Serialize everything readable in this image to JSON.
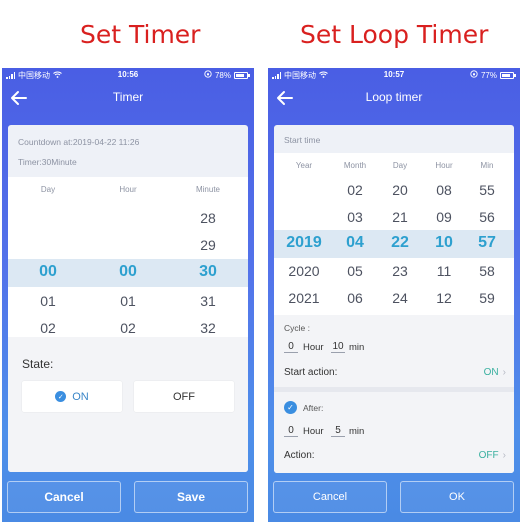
{
  "captions": {
    "left": "Set Timer",
    "right": "Set Loop Timer"
  },
  "left": {
    "status": {
      "carrier": "中国移动",
      "time": "10:56",
      "battery": "78%",
      "battery_level": 0.78
    },
    "title": "Timer",
    "countdown": "Countdown at:2019-04-22 11:26",
    "timer": "Timer:30Minute",
    "columns": [
      "Day",
      "Hour",
      "Minute"
    ],
    "wheels": [
      [
        "",
        "",
        "00",
        "01",
        "02"
      ],
      [
        "",
        "",
        "00",
        "01",
        "02"
      ],
      [
        "28",
        "29",
        "30",
        "31",
        "32"
      ]
    ],
    "state_label": "State:",
    "on_label": "ON",
    "off_label": "OFF",
    "cancel": "Cancel",
    "save": "Save"
  },
  "right": {
    "status": {
      "carrier": "中国移动",
      "time": "10:57",
      "battery": "77%",
      "battery_level": 0.77
    },
    "title": "Loop timer",
    "start_time": "Start time",
    "columns": [
      "Year",
      "Month",
      "Day",
      "Hour",
      "Min"
    ],
    "wheels": [
      [
        "",
        "",
        "2019",
        "2020",
        "2021"
      ],
      [
        "02",
        "03",
        "04",
        "05",
        "06"
      ],
      [
        "20",
        "21",
        "22",
        "23",
        "24"
      ],
      [
        "08",
        "09",
        "10",
        "11",
        "12"
      ],
      [
        "55",
        "56",
        "57",
        "58",
        "59"
      ]
    ],
    "cycle_label": "Cycle :",
    "cycle_hour": "0",
    "hour_unit": "Hour",
    "cycle_min": "10",
    "min_unit": "min",
    "start_action_label": "Start action:",
    "start_action_value": "ON",
    "after_label": "After:",
    "after_hour": "0",
    "after_min": "5",
    "action_label": "Action:",
    "action_value": "OFF",
    "cancel": "Cancel",
    "ok": "OK"
  }
}
